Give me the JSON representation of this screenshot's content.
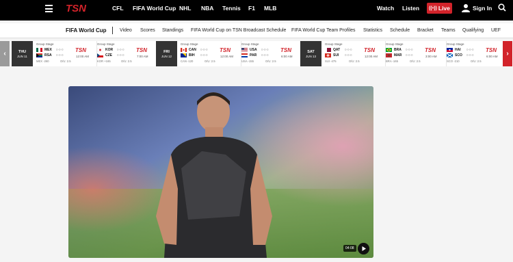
{
  "nav": {
    "links": [
      "CFL",
      "FIFA World Cup",
      "NHL",
      "NBA",
      "Tennis",
      "F1",
      "MLB"
    ],
    "right": {
      "watch": "Watch",
      "listen": "Listen",
      "live": "Live",
      "signin": "Sign In"
    }
  },
  "subnav": {
    "primary": "FIFA World Cup",
    "items": [
      "Video",
      "Scores",
      "Standings",
      "FIFA World Cup on TSN Broadcast Schedule",
      "FIFA World Cup Team Profiles",
      "Statistics",
      "Schedule",
      "Bracket",
      "Teams",
      "Qualifying",
      "UEF"
    ]
  },
  "scoreboard": {
    "days": [
      {
        "day": "THU",
        "date": "JUN 11"
      },
      {
        "day": "FRI",
        "date": "JUN 12"
      },
      {
        "day": "SAT",
        "date": "JUN 13"
      }
    ],
    "games": [
      {
        "stage": "Group Stage",
        "t1": "MEX",
        "t2": "RSA",
        "rec1": "0-0-0",
        "rec2": "0-0-0",
        "time": "12:00 AM",
        "line": "MEX -260",
        "ou": "O/U: 2.5"
      },
      {
        "stage": "Group Stage",
        "t1": "KOR",
        "t2": "CZE",
        "rec1": "0-0-0",
        "rec2": "0-0-0",
        "time": "7:00 AM",
        "line": "KOR +165",
        "ou": "O/U: 2.5"
      },
      {
        "stage": "Group Stage",
        "t1": "CAN",
        "t2": "BIH",
        "rec1": "0-0-0",
        "rec2": "0-0-0",
        "time": "12:00 AM",
        "line": "CAN -120",
        "ou": "O/U: 2.5"
      },
      {
        "stage": "Group Stage",
        "t1": "USA",
        "t2": "PAR",
        "rec1": "0-0-0",
        "rec2": "0-0-0",
        "time": "6:00 AM",
        "line": "USA -155",
        "ou": "O/U: 2.5"
      },
      {
        "stage": "Group Stage",
        "t1": "QAT",
        "t2": "SUI",
        "rec1": "0-0-0",
        "rec2": "0-0-0",
        "time": "12:00 AM",
        "line": "SUI -475",
        "ou": "O/U: 2.5"
      },
      {
        "stage": "Group Stage",
        "t1": "BRA",
        "t2": "MAR",
        "rec1": "0-0-0",
        "rec2": "0-0-0",
        "time": "3:00 AM",
        "line": "BRA -165",
        "ou": "O/U: 2.5"
      },
      {
        "stage": "Group Stage",
        "t1": "HAI",
        "t2": "SCO",
        "rec1": "0-0-0",
        "rec2": "0-0-0",
        "time": "6:00 AM",
        "line": "SCO -210",
        "ou": "O/U: 2.5"
      }
    ]
  },
  "video": {
    "duration": "04:08"
  },
  "colors": {
    "brand": "#d2232a",
    "nav_bg": "#000000",
    "day_bg": "#333333"
  }
}
